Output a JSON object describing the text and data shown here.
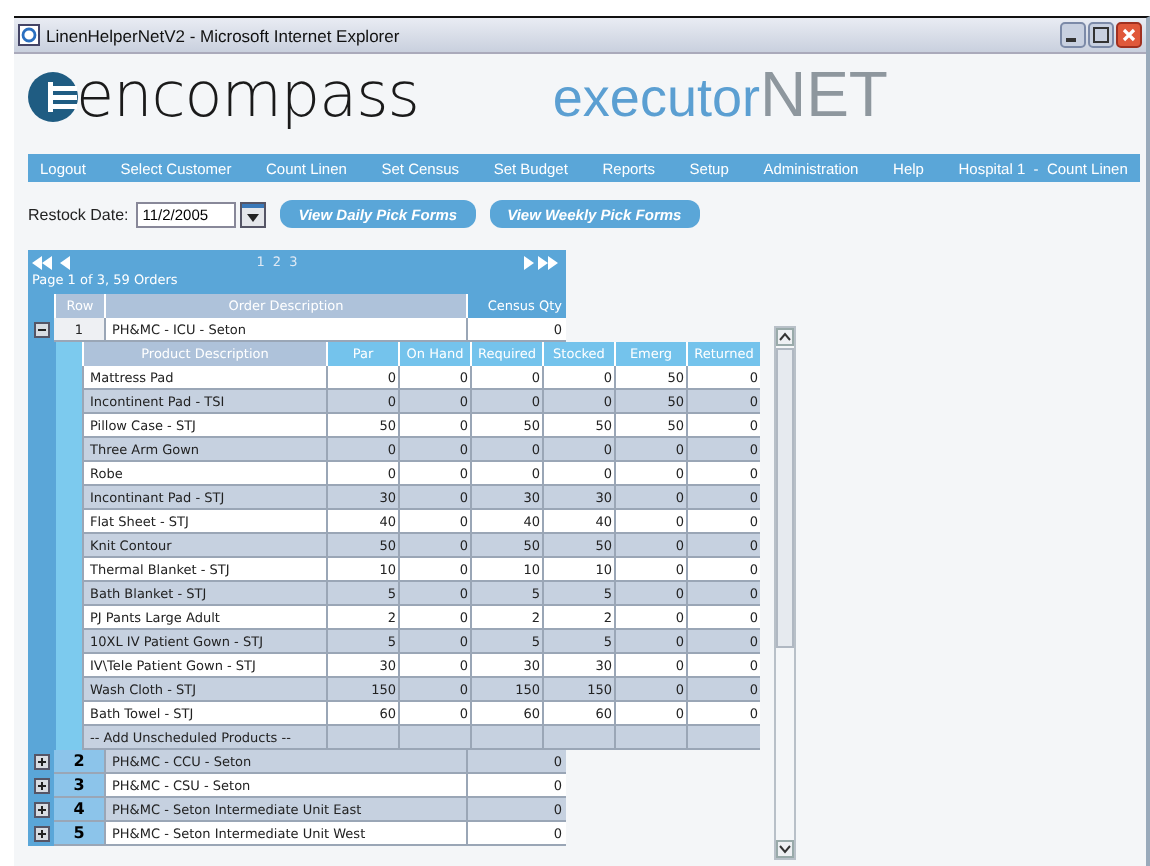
{
  "window": {
    "title": "LinenHelperNetV2 - Microsoft Internet Explorer"
  },
  "logo": {
    "brand": "encompass",
    "product_light": "executor",
    "product_dark": "NET"
  },
  "menu": [
    "Logout",
    "Select Customer",
    "Count Linen",
    "Set Census",
    "Set Budget",
    "Reports",
    "Setup",
    "Administration",
    "Help",
    "Hospital 1  -  Count Linen"
  ],
  "restock": {
    "label": "Restock Date:",
    "value": "11/2/2005"
  },
  "buttons": [
    "View Daily Pick Forms",
    "View Weekly Pick Forms"
  ],
  "grid": {
    "pages": [
      "1",
      "2",
      "3"
    ],
    "summary": "Page 1 of 3, 59 Orders",
    "columns": [
      "Row",
      "Order Description",
      "Census Qty"
    ],
    "orders": [
      {
        "row": "1",
        "description": "PH&MC - ICU - Seton",
        "census": "0",
        "expanded": true,
        "details": {
          "columns": [
            "Product Description",
            "Par",
            "On Hand",
            "Required",
            "Stocked",
            "Emerg",
            "Returned"
          ],
          "rows": [
            [
              "Mattress Pad",
              "0",
              "0",
              "0",
              "0",
              "50",
              "0"
            ],
            [
              "Incontinent Pad - TSI",
              "0",
              "0",
              "0",
              "0",
              "50",
              "0"
            ],
            [
              "Pillow Case - STJ",
              "50",
              "0",
              "50",
              "50",
              "50",
              "0"
            ],
            [
              "Three Arm Gown",
              "0",
              "0",
              "0",
              "0",
              "0",
              "0"
            ],
            [
              "Robe",
              "0",
              "0",
              "0",
              "0",
              "0",
              "0"
            ],
            [
              "Incontinant Pad - STJ",
              "30",
              "0",
              "30",
              "30",
              "0",
              "0"
            ],
            [
              "Flat Sheet - STJ",
              "40",
              "0",
              "40",
              "40",
              "0",
              "0"
            ],
            [
              "Knit Contour",
              "50",
              "0",
              "50",
              "50",
              "0",
              "0"
            ],
            [
              "Thermal Blanket - STJ",
              "10",
              "0",
              "10",
              "10",
              "0",
              "0"
            ],
            [
              "Bath Blanket - STJ",
              "5",
              "0",
              "5",
              "5",
              "0",
              "0"
            ],
            [
              "PJ Pants Large Adult",
              "2",
              "0",
              "2",
              "2",
              "0",
              "0"
            ],
            [
              "10XL IV Patient Gown - STJ",
              "5",
              "0",
              "5",
              "5",
              "0",
              "0"
            ],
            [
              "IV\\Tele Patient Gown - STJ",
              "30",
              "0",
              "30",
              "30",
              "0",
              "0"
            ],
            [
              "Wash Cloth - STJ",
              "150",
              "0",
              "150",
              "150",
              "0",
              "0"
            ],
            [
              "Bath Towel - STJ",
              "60",
              "0",
              "60",
              "60",
              "0",
              "0"
            ]
          ],
          "add_label": "-- Add Unscheduled Products --"
        }
      },
      {
        "row": "2",
        "description": "PH&MC - CCU - Seton",
        "census": "0",
        "expanded": false
      },
      {
        "row": "3",
        "description": "PH&MC - CSU - Seton",
        "census": "0",
        "expanded": false
      },
      {
        "row": "4",
        "description": "PH&MC - Seton Intermediate Unit East",
        "census": "0",
        "expanded": false
      },
      {
        "row": "5",
        "description": "PH&MC - Seton Intermediate Unit West",
        "census": "0",
        "expanded": false
      }
    ]
  }
}
